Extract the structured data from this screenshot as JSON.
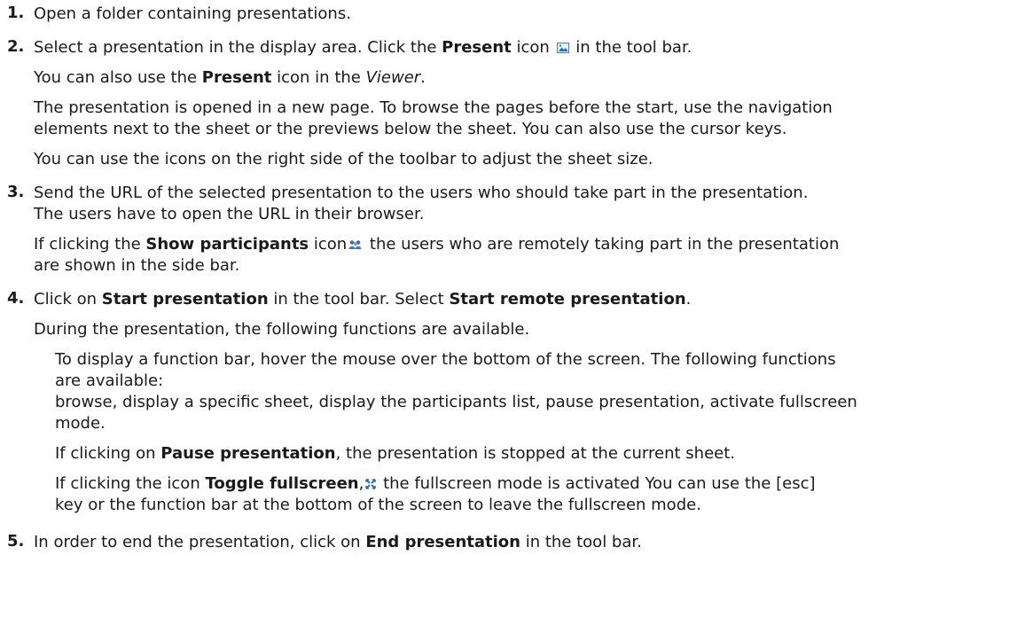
{
  "icons": {
    "present": "present-icon",
    "participants": "participants-icon",
    "fullscreen": "fullscreen-icon"
  },
  "steps": [
    {
      "num": "1.",
      "l1": "Open a folder containing presentations."
    },
    {
      "num": "2.",
      "l1a": "Select a presentation in the display area. Click the ",
      "l1b": "Present",
      "l1c": " icon",
      "l1d": " in the tool bar.",
      "l2a": "You can also use the ",
      "l2b": "Present",
      "l2c": " icon in the ",
      "l2d": "Viewer",
      "l2e": ".",
      "l3a": "The presentation is opened in a new page. To browse the pages before the start, use the navigation",
      "l3b": "elements next to the sheet or the previews below the sheet. You can also use the cursor keys.",
      "l4": "You can use the icons on the right side of the toolbar to adjust the sheet size."
    },
    {
      "num": "3.",
      "l1a": "Send the URL of the selected presentation to the users who should take part in the presentation.",
      "l1b": "The users have to open the URL in their browser.",
      "l2a": "If clicking the ",
      "l2b": "Show participants",
      "l2c": " icon",
      "l2d": " the users who are remotely taking part in the presentation",
      "l2e": "are shown in the side bar."
    },
    {
      "num": "4.",
      "l1a": "Click on ",
      "l1b": "Start presentation",
      "l1c": " in the tool bar. Select ",
      "l1d": "Start remote presentation",
      "l1e": ".",
      "l2": "During the presentation, the following functions are available.",
      "s1a": "To display a function bar, hover the mouse over the bottom of the screen. The following functions",
      "s1b": "are available:",
      "s1c": "browse, display a specific sheet, display the participants list, pause presentation, activate fullscreen",
      "s1d": "mode.",
      "s2a": "If clicking on ",
      "s2b": "Pause presentation",
      "s2c": ", the presentation is stopped at the current sheet.",
      "s3a": "If clicking the icon ",
      "s3b": "Toggle fullscreen",
      "s3c": ",",
      "s3d": " the fullscreen mode is activated You can use the [esc]",
      "s3e": "key or the function bar at the bottom of the screen to leave the fullscreen mode."
    },
    {
      "num": "5.",
      "l1a": "In order to end the presentation, click on ",
      "l1b": "End presentation",
      "l1c": " in the tool bar."
    }
  ]
}
